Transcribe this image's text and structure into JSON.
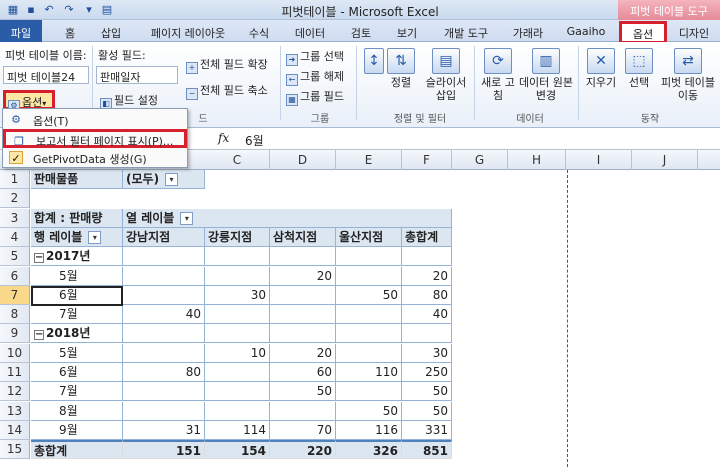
{
  "window": {
    "title": "피벗테이블 - Microsoft Excel",
    "context_tab": "피벗 테이블 도구"
  },
  "tabs": [
    "파일",
    "홈",
    "삽입",
    "페이지 레이아웃",
    "수식",
    "데이터",
    "검토",
    "보기",
    "개발 도구",
    "가래라",
    "Gaaiho",
    "옵션",
    "디자인"
  ],
  "ribbon": {
    "pivot_name_label": "피벗 테이블 이름:",
    "pivot_name_value": "피벗 테이블24",
    "options_button": "옵션",
    "active_field_label": "활성 필드:",
    "active_field_value": "판매일자",
    "field_settings": "필드 설정",
    "expand_all": "전체 필드 확장",
    "collapse_all": "전체 필드 축소",
    "group_selection": "그룹 선택",
    "ungroup": "그룹 해제",
    "group_field": "그룹 필드",
    "group_label_group": "그룹",
    "sort": "정렬",
    "slicer": "슬라이서 삽입",
    "sort_filter_group": "정렬 및 필터",
    "refresh": "새로 고침",
    "change_source": "데이터 원본 변경",
    "data_group": "데이터",
    "clear": "지우기",
    "select": "선택",
    "move_pivot": "피벗 테이블 이동",
    "actions_group": "동작",
    "active_field_group_tail": "드"
  },
  "menu": {
    "items": [
      "옵션(T)",
      "보고서 필터 페이지 표시(P)...",
      "GetPivotData 생성(G)"
    ]
  },
  "formula": {
    "fx": "fx",
    "value": "6월"
  },
  "columns": [
    "C",
    "D",
    "E",
    "F",
    "G",
    "H",
    "I",
    "J"
  ],
  "rows": [
    "1",
    "2",
    "3",
    "4",
    "5",
    "6",
    "7",
    "8",
    "9",
    "10",
    "11",
    "12",
    "13",
    "14",
    "15"
  ],
  "pivot": {
    "filter_label": "판매물품",
    "filter_value": "(모두)",
    "sum_label": "합계 : 판매량",
    "col_labels": "열 레이블",
    "row_labels": "행 레이블",
    "headers": [
      "강남지점",
      "강릉지점",
      "삼척지점",
      "울산지점",
      "총합계"
    ],
    "year1": "2017년",
    "year2": "2018년",
    "data": [
      {
        "label": "5월",
        "v": [
          "",
          "",
          "20",
          "",
          "20"
        ]
      },
      {
        "label": "6월",
        "v": [
          "",
          "30",
          "",
          "50",
          "80"
        ]
      },
      {
        "label": "7월",
        "v": [
          "40",
          "",
          "",
          "",
          "40"
        ]
      },
      {
        "label": "5월",
        "v": [
          "",
          "10",
          "20",
          "",
          "30"
        ]
      },
      {
        "label": "6월",
        "v": [
          "80",
          "",
          "60",
          "110",
          "250"
        ]
      },
      {
        "label": "7월",
        "v": [
          "",
          "",
          "50",
          "",
          "50"
        ]
      },
      {
        "label": "8월",
        "v": [
          "",
          "",
          "",
          "50",
          "50"
        ]
      },
      {
        "label": "9월",
        "v": [
          "31",
          "114",
          "70",
          "116",
          "331"
        ]
      }
    ],
    "total_label": "총합계",
    "total": [
      "151",
      "154",
      "220",
      "326",
      "851"
    ]
  }
}
